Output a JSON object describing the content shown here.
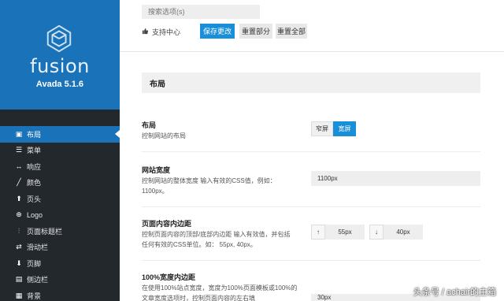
{
  "brand": {
    "name": "fusion",
    "version": "Avada 5.1.6",
    "logo_icon": "fusion-logo-icon"
  },
  "nav": {
    "items": [
      {
        "label": "布局",
        "icon": "layout-icon",
        "glyph": "▣",
        "active": true
      },
      {
        "label": "菜单",
        "icon": "menu-icon",
        "glyph": "☰",
        "active": false
      },
      {
        "label": "响应",
        "icon": "responsive-icon",
        "glyph": "↔",
        "active": false
      },
      {
        "label": "颜色",
        "icon": "brush-icon",
        "glyph": "╱",
        "active": false
      },
      {
        "label": "页头",
        "icon": "arrow-up-icon",
        "glyph": "⬆",
        "active": false
      },
      {
        "label": "Logo",
        "icon": "plus-circle-icon",
        "glyph": "⊕",
        "active": false
      },
      {
        "label": "页面标题栏",
        "icon": "sliders-icon",
        "glyph": "⫶",
        "active": false
      },
      {
        "label": "滑动栏",
        "icon": "slider-icon",
        "glyph": "⇄",
        "active": false
      },
      {
        "label": "页脚",
        "icon": "arrow-down-icon",
        "glyph": "⬇",
        "active": false
      },
      {
        "label": "侧边栏",
        "icon": "sidebar-icon",
        "glyph": "▤",
        "active": false
      },
      {
        "label": "背景",
        "icon": "background-icon",
        "glyph": "▦",
        "active": false
      }
    ]
  },
  "topbar": {
    "search_placeholder": "搜索选项(s)",
    "support_label": "支持中心",
    "save_label": "保存更改",
    "reset_section_label": "重置部分",
    "reset_all_label": "重置全部"
  },
  "section": {
    "title": "布局"
  },
  "layout_row": {
    "title": "布局",
    "desc": "控制网站的布局",
    "option_narrow": "窄屏",
    "option_wide": "宽屏",
    "selected": "宽屏"
  },
  "width_row": {
    "title": "网站宽度",
    "desc": "控制网站的整体宽度 输入有效的CSS值，例如：1100px。",
    "value": "1100px"
  },
  "padding_row": {
    "title": "页面内容内边距",
    "desc": "控制页面内容的顶部/底部内边距 输入有效值，并包括任何有效的CSS单位。如： 55px, 40px。",
    "top_arrow": "↑",
    "top_value": "55px",
    "bottom_arrow": "↓",
    "bottom_value": "40px"
  },
  "full_row": {
    "title": "100%宽度内边距",
    "desc": "在使用100%站点宽度，宽度为100%页面模板或100%的文章宽度选项时，控制页面内容的左右填",
    "value": "30px"
  },
  "watermark": "头条号 / achair的主箱",
  "colors": {
    "accent": "#1a8fd9",
    "brand_bg": "#1a73b8",
    "sidebar_bg": "#23282d"
  }
}
